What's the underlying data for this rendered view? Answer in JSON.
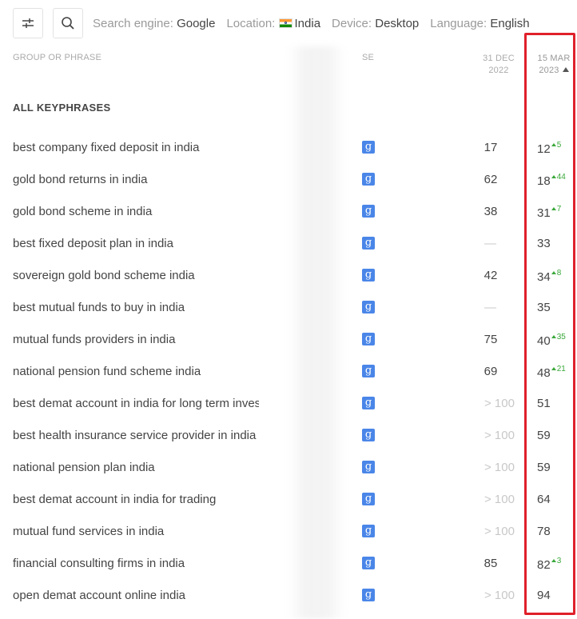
{
  "toolbar": {
    "filters_icon": "sliders-icon",
    "search_icon": "search-icon",
    "search_engine_label": "Search engine:",
    "search_engine_value": "Google",
    "location_label": "Location:",
    "location_value": "India",
    "location_flag": "india-flag-icon",
    "device_label": "Device:",
    "device_value": "Desktop",
    "language_label": "Language:",
    "language_value": "English"
  },
  "table": {
    "headers": {
      "group": "GROUP OR PHRASE",
      "se": "SE",
      "date1_line1": "31 DEC",
      "date1_line2": "2022",
      "date2_line1": "15 MAR",
      "date2_line2": "2023"
    },
    "group_label": "ALL KEYPHRASES",
    "se_icon": "google-g-icon",
    "rows": [
      {
        "phrase": "best company fixed deposit in india",
        "d1": "17",
        "d2": "12",
        "delta": "5"
      },
      {
        "phrase": "gold bond returns in india",
        "d1": "62",
        "d2": "18",
        "delta": "44"
      },
      {
        "phrase": "gold bond scheme in india",
        "d1": "38",
        "d2": "31",
        "delta": "7"
      },
      {
        "phrase": "best fixed deposit plan in india",
        "d1": "—",
        "d2": "33",
        "delta": ""
      },
      {
        "phrase": "sovereign gold bond scheme india",
        "d1": "42",
        "d2": "34",
        "delta": "8"
      },
      {
        "phrase": "best mutual funds to buy in india",
        "d1": "—",
        "d2": "35",
        "delta": ""
      },
      {
        "phrase": "mutual funds providers in india",
        "d1": "75",
        "d2": "40",
        "delta": "35"
      },
      {
        "phrase": "national pension fund scheme india",
        "d1": "69",
        "d2": "48",
        "delta": "21"
      },
      {
        "phrase": "best demat account in india for long term inves",
        "d1": "> 100",
        "d2": "51",
        "delta": ""
      },
      {
        "phrase": "best health insurance service provider in india",
        "d1": "> 100",
        "d2": "59",
        "delta": ""
      },
      {
        "phrase": "national pension plan india",
        "d1": "> 100",
        "d2": "59",
        "delta": ""
      },
      {
        "phrase": "best demat account in india for trading",
        "d1": "> 100",
        "d2": "64",
        "delta": ""
      },
      {
        "phrase": "mutual fund services in india",
        "d1": "> 100",
        "d2": "78",
        "delta": ""
      },
      {
        "phrase": "financial consulting firms in india",
        "d1": "85",
        "d2": "82",
        "delta": "3"
      },
      {
        "phrase": "open demat account online india",
        "d1": "> 100",
        "d2": "94",
        "delta": ""
      }
    ]
  },
  "colors": {
    "highlight": "#e0202a",
    "positive_delta": "#3aa83a",
    "google_badge": "#4a86e8"
  }
}
